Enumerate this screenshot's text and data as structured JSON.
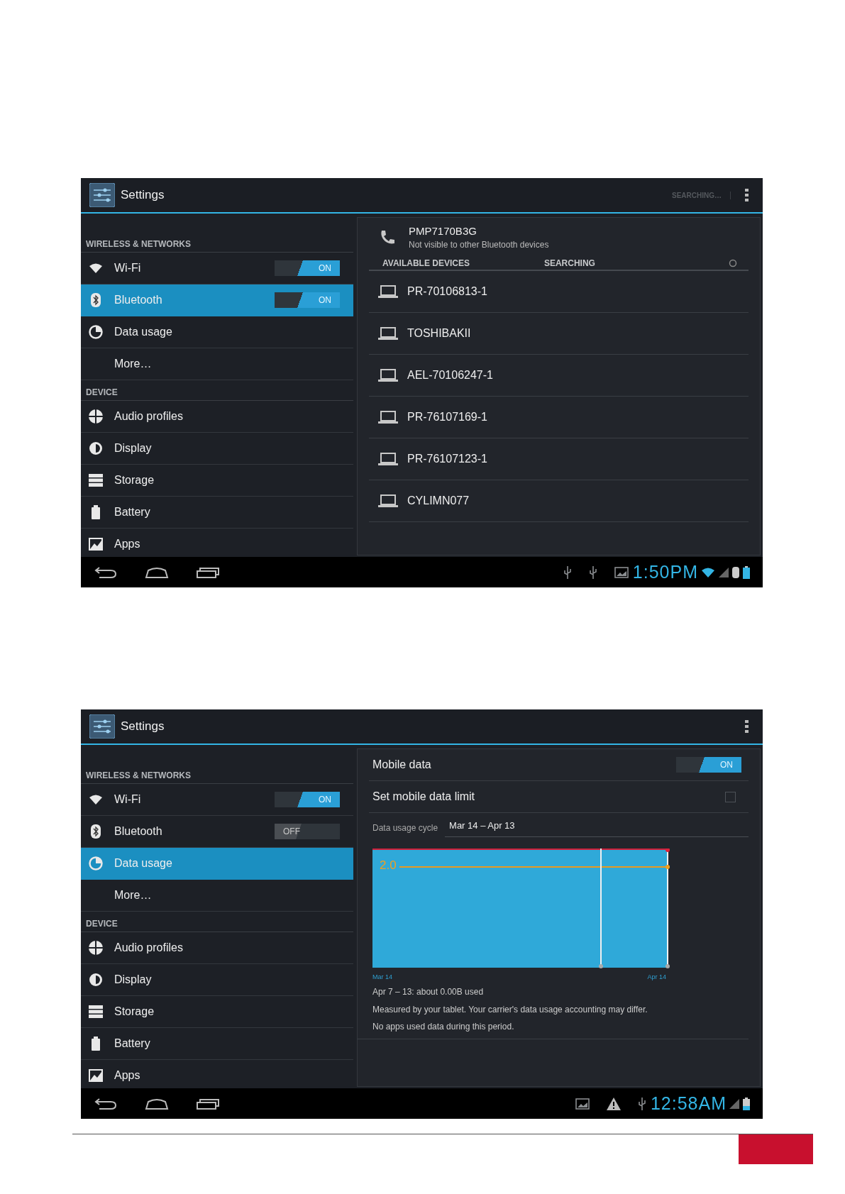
{
  "screens": [
    {
      "action_bar": {
        "title": "Settings",
        "status": "SEARCHING…"
      },
      "sidebar": {
        "sections": [
          {
            "header": "WIRELESS & NETWORKS",
            "items": [
              {
                "label": "Wi-Fi",
                "selected": false,
                "toggle": {
                  "label": "ON",
                  "on": true
                }
              },
              {
                "label": "Bluetooth",
                "selected": true,
                "toggle": {
                  "label": "ON",
                  "on": true
                }
              },
              {
                "label": "Data usage",
                "selected": false
              },
              {
                "label": "More…",
                "selected": false
              }
            ]
          },
          {
            "header": "DEVICE",
            "items": [
              {
                "label": "Audio profiles",
                "selected": false
              },
              {
                "label": "Display",
                "selected": false
              },
              {
                "label": "Storage",
                "selected": false
              },
              {
                "label": "Battery",
                "selected": false
              },
              {
                "label": "Apps",
                "selected": false
              }
            ]
          }
        ]
      },
      "detail": {
        "kind": "bluetooth",
        "device_name": "PMP7170B3G",
        "visibility": "Not visible to other Bluetooth devices",
        "list_header": "AVAILABLE DEVICES",
        "list_status": "SEARCHING",
        "devices": [
          "PR-70106813-1",
          "TOSHIBAKII",
          "AEL-70106247-1",
          "PR-76107169-1",
          "PR-76107123-1",
          "CYLIMN077"
        ]
      },
      "nav_bar": {
        "time": "1:50PM"
      }
    },
    {
      "action_bar": {
        "title": "Settings"
      },
      "sidebar": {
        "sections": [
          {
            "header": "WIRELESS & NETWORKS",
            "items": [
              {
                "label": "Wi-Fi",
                "selected": false,
                "toggle": {
                  "label": "ON",
                  "on": true
                }
              },
              {
                "label": "Bluetooth",
                "selected": false,
                "toggle": {
                  "label": "OFF",
                  "on": false
                }
              },
              {
                "label": "Data usage",
                "selected": true
              },
              {
                "label": "More…",
                "selected": false
              }
            ]
          },
          {
            "header": "DEVICE",
            "items": [
              {
                "label": "Audio profiles",
                "selected": false
              },
              {
                "label": "Display",
                "selected": false
              },
              {
                "label": "Storage",
                "selected": false
              },
              {
                "label": "Battery",
                "selected": false
              },
              {
                "label": "Apps",
                "selected": false
              }
            ]
          }
        ]
      },
      "detail": {
        "kind": "data_usage",
        "mobile_data": {
          "label": "Mobile data",
          "toggle": {
            "label": "ON",
            "on": true
          }
        },
        "limit": {
          "label": "Set mobile data limit",
          "checked": false
        },
        "cycle": {
          "label": "Data usage cycle",
          "value": "Mar 14 – Apr 13"
        },
        "chart": {
          "warning": "2.0",
          "start": "Mar 14",
          "end": "Apr 14"
        },
        "notes": [
          "Apr 7 – 13: about 0.00B used",
          "Measured by your tablet. Your carrier's data usage accounting may differ.",
          "No apps used data during this period."
        ]
      },
      "nav_bar": {
        "time": "12:58AM"
      }
    }
  ]
}
